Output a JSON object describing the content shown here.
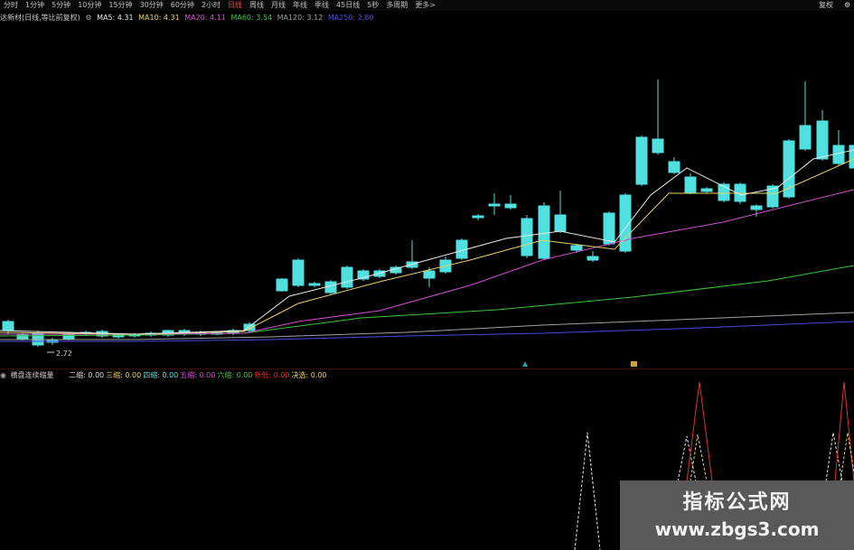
{
  "toolbar": {
    "periods": [
      "分时",
      "1分钟",
      "5分钟",
      "10分钟",
      "15分钟",
      "30分钟",
      "60分钟",
      "2小时",
      "日线",
      "周线",
      "月线",
      "年线",
      "季线",
      "45日线",
      "5秒",
      "多周期",
      "更多>"
    ],
    "active_period": "日线",
    "right_buttons": [
      "复权",
      "⚙"
    ]
  },
  "ma_bar": {
    "stock": "达新材(日线,等比前复权)",
    "ma5": {
      "label": "MA5: 4.31",
      "color": "#e8e8e8"
    },
    "ma10": {
      "label": "MA10: 4.31",
      "color": "#e6d36a"
    },
    "ma20": {
      "label": "MA20: 4.11",
      "color": "#d04fd0"
    },
    "ma60": {
      "label": "MA60: 3.54",
      "color": "#3cc43c"
    },
    "ma120": {
      "label": "MA120: 3.12",
      "color": "#a0a0a0"
    },
    "ma250": {
      "label": "MA250: 2.80",
      "color": "#4a4ae0"
    }
  },
  "main_chart": {
    "low_marker": "2.72",
    "colors": {
      "up": "#e03030",
      "down": "#4fe0e0"
    }
  },
  "indicator_bar": {
    "name": "横盘连续缩量",
    "items": [
      {
        "label": "二缩: 0.00",
        "color": "#dcdcdc"
      },
      {
        "label": "三缩: 0.00",
        "color": "#e6d36a"
      },
      {
        "label": "四缩: 0.00",
        "color": "#4fe0e0"
      },
      {
        "label": "五缩: 0.00",
        "color": "#d04fd0"
      },
      {
        "label": "六缩: 0.00",
        "color": "#3cc43c"
      },
      {
        "label": "新低: 0.00",
        "color": "#e03030"
      },
      {
        "label": "决选: 0.00",
        "color": "#e6d36a"
      }
    ]
  },
  "watermark": {
    "title": "指标公式网",
    "url": "www.zbgs3.com"
  }
}
